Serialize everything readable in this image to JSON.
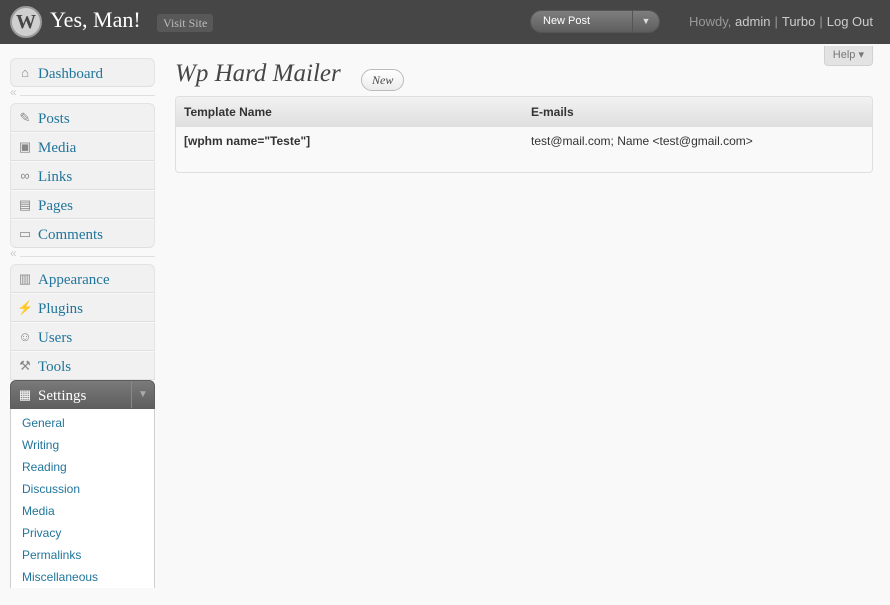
{
  "header": {
    "site_title": "Yes, Man!",
    "visit_site": "Visit Site",
    "favorite_action": "New Post",
    "howdy": "Howdy,",
    "username": "admin",
    "turbo": "Turbo",
    "logout": "Log Out"
  },
  "menu": {
    "dashboard": "Dashboard",
    "posts": "Posts",
    "media": "Media",
    "links": "Links",
    "pages": "Pages",
    "comments": "Comments",
    "appearance": "Appearance",
    "plugins": "Plugins",
    "users": "Users",
    "tools": "Tools",
    "settings": "Settings",
    "settings_submenu": [
      "General",
      "Writing",
      "Reading",
      "Discussion",
      "Media",
      "Privacy",
      "Permalinks",
      "Miscellaneous"
    ]
  },
  "help_tab": "Help",
  "page": {
    "title": "Wp Hard Mailer",
    "add_new": "New"
  },
  "table": {
    "columns": [
      "Template Name",
      "E-mails"
    ],
    "rows": [
      [
        "[wphm name=\"Teste\"]",
        "test@mail.com; Name <test@gmail.com>"
      ]
    ]
  }
}
